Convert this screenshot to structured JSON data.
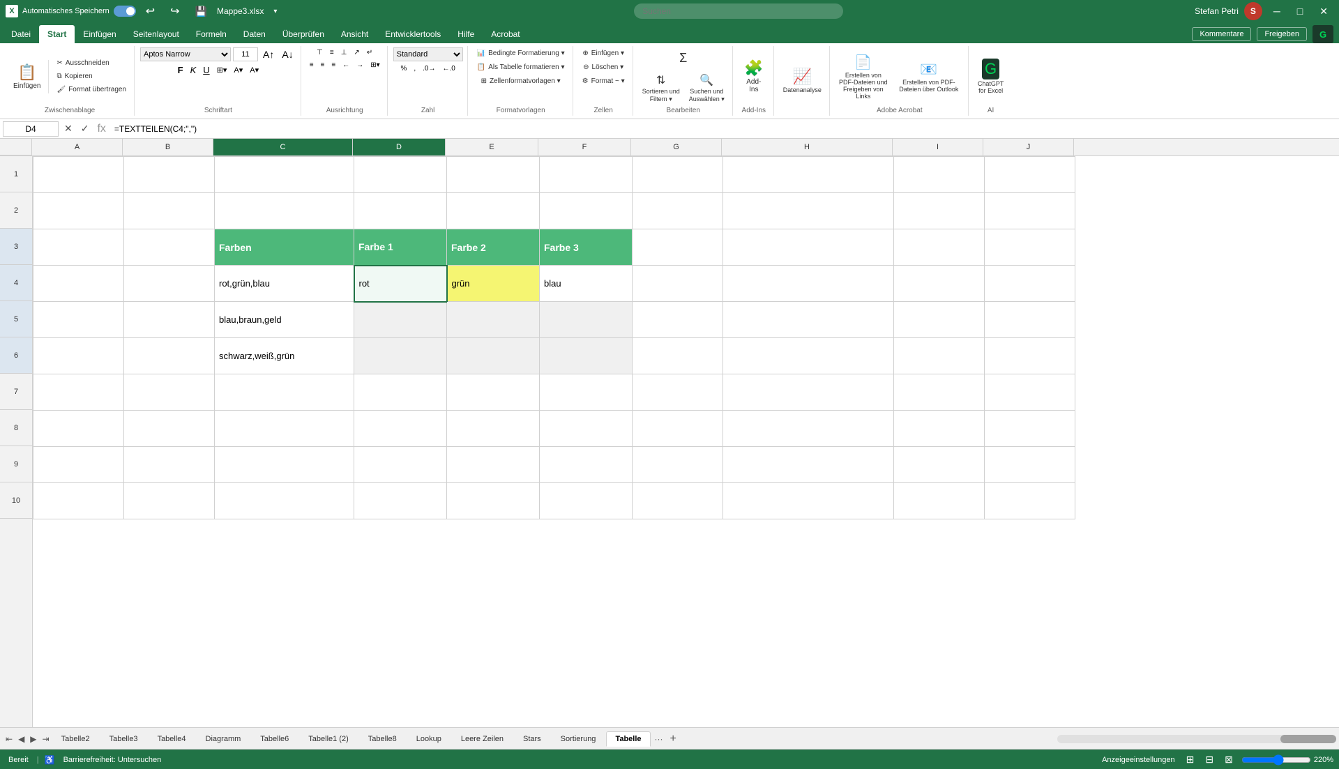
{
  "titlebar": {
    "app_icon": "X",
    "autosave_label": "Automatisches Speichern",
    "file_name": "Mappe3.xlsx",
    "user_name": "Stefan Petri",
    "minimize_btn": "─",
    "restore_btn": "□",
    "close_btn": "✕"
  },
  "ribbon": {
    "tabs": [
      {
        "id": "datei",
        "label": "Datei"
      },
      {
        "id": "start",
        "label": "Start",
        "active": true
      },
      {
        "id": "einfuegen",
        "label": "Einfügen"
      },
      {
        "id": "seitenlayout",
        "label": "Seitenlayout"
      },
      {
        "id": "formeln",
        "label": "Formeln"
      },
      {
        "id": "daten",
        "label": "Daten"
      },
      {
        "id": "ueberpruefen",
        "label": "Überprüfen"
      },
      {
        "id": "ansicht",
        "label": "Ansicht"
      },
      {
        "id": "entwicklertools",
        "label": "Entwicklertools"
      },
      {
        "id": "hilfe",
        "label": "Hilfe"
      },
      {
        "id": "acrobat",
        "label": "Acrobat"
      }
    ],
    "groups": {
      "zwischenablage": {
        "label": "Zwischenablage",
        "paste_btn": "Einfügen",
        "cut_btn": "Ausschneiden",
        "copy_btn": "Kopieren",
        "format_painter_btn": "Format übertragen"
      },
      "schriftart": {
        "label": "Schriftart",
        "font": "Aptos Narrow",
        "size": "11",
        "bold": "F",
        "italic": "K",
        "underline": "U"
      },
      "ausrichtung": {
        "label": "Ausrichtung"
      },
      "zahl": {
        "label": "Zahl",
        "format": "Standard"
      },
      "formatvorlagen": {
        "label": "Formatvorlagen",
        "conditional": "Bedingte Formatierung",
        "table": "Als Tabelle formatieren",
        "cell_styles": "Zellenformatvorlagen"
      },
      "zellen": {
        "label": "Zellen",
        "insert": "Einfügen",
        "delete": "Löschen",
        "format": "Format ~"
      },
      "bearbeiten": {
        "label": "Bearbeiten",
        "sort_filter": "Sortieren und Filtern",
        "find_select": "Suchen und Auswählen"
      },
      "addins": {
        "label": "Add-Ins"
      }
    }
  },
  "formula_bar": {
    "cell_ref": "D4",
    "formula": "=TEXTTEILEN(C4;\",\")"
  },
  "search_placeholder": "Suchen",
  "columns": [
    "A",
    "B",
    "C",
    "D",
    "E",
    "F",
    "G",
    "H",
    "I",
    "J"
  ],
  "rows": [
    1,
    2,
    3,
    4,
    5,
    6,
    7,
    8,
    9,
    10
  ],
  "cell_data": {
    "C3": {
      "value": "Farben",
      "type": "header"
    },
    "D3": {
      "value": "Farbe 1",
      "type": "header"
    },
    "E3": {
      "value": "Farbe 2",
      "type": "header"
    },
    "F3": {
      "value": "Farbe 3",
      "type": "header"
    },
    "C4": {
      "value": "rot,grün,blau",
      "type": "data"
    },
    "D4": {
      "value": "rot",
      "type": "active"
    },
    "E4": {
      "value": "grün",
      "type": "highlighted"
    },
    "F4": {
      "value": "blau",
      "type": "data"
    },
    "C5": {
      "value": "blau,braun,geld",
      "type": "data"
    },
    "D5": {
      "value": "",
      "type": "empty-colored"
    },
    "E5": {
      "value": "",
      "type": "empty-colored"
    },
    "F5": {
      "value": "",
      "type": "empty-colored"
    },
    "C6": {
      "value": "schwarz,weiß,grün",
      "type": "data"
    },
    "D6": {
      "value": "",
      "type": "empty-colored"
    },
    "E6": {
      "value": "",
      "type": "empty-colored"
    },
    "F6": {
      "value": "",
      "type": "empty-colored"
    }
  },
  "sheet_tabs": [
    {
      "id": "tabelle2",
      "label": "Tabelle2"
    },
    {
      "id": "tabelle3",
      "label": "Tabelle3"
    },
    {
      "id": "tabelle4",
      "label": "Tabelle4"
    },
    {
      "id": "diagramm",
      "label": "Diagramm"
    },
    {
      "id": "tabelle6",
      "label": "Tabelle6"
    },
    {
      "id": "tabelle1_2",
      "label": "Tabelle1 (2)"
    },
    {
      "id": "tabelle8",
      "label": "Tabelle8"
    },
    {
      "id": "lookup",
      "label": "Lookup"
    },
    {
      "id": "leere_zeilen",
      "label": "Leere Zeilen"
    },
    {
      "id": "stars",
      "label": "Stars"
    },
    {
      "id": "sortierung",
      "label": "Sortierung"
    },
    {
      "id": "tabelle",
      "label": "Tabelle",
      "active": true
    }
  ],
  "status_bar": {
    "status": "Bereit",
    "accessibility": "Barrierefreiheit: Untersuchen",
    "display_settings": "Anzeigeeinstellungen",
    "zoom": "220%"
  },
  "colors": {
    "header_bg": "#4db87a",
    "header_text": "#ffffff",
    "active_tab": "#217346",
    "grid_line": "#d0d0d0",
    "highlight_yellow": "#f5f572",
    "empty_cell_bg": "#f0f0f0"
  }
}
